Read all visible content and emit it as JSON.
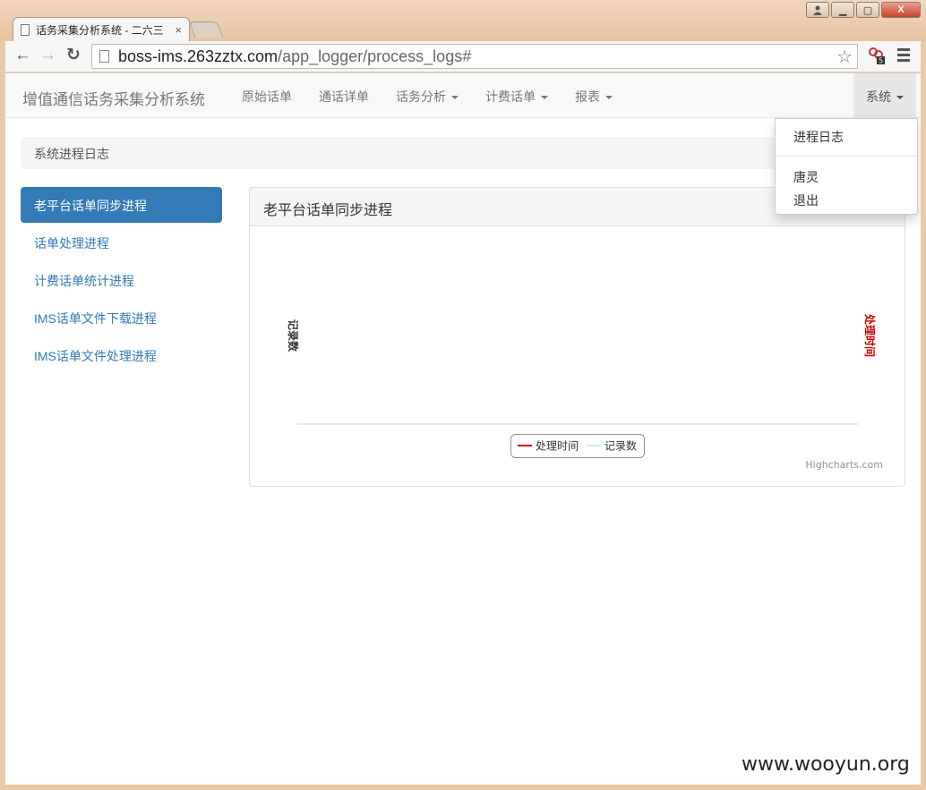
{
  "browser": {
    "tab_title": "话务采集分析系统 - 二六三",
    "tab_close": "×",
    "url_host": "boss-ims.263zztx.com",
    "url_path": "/app_logger/process_logs#",
    "ext_badge": "5",
    "window_buttons": {
      "minimize": "▁",
      "maximize": "▢",
      "close": "X"
    }
  },
  "navbar": {
    "brand": "增值通信话务采集分析系统",
    "items": [
      {
        "label": "原始话单",
        "dropdown": false
      },
      {
        "label": "通话详单",
        "dropdown": false
      },
      {
        "label": "话务分析",
        "dropdown": true
      },
      {
        "label": "计费话单",
        "dropdown": true
      },
      {
        "label": "报表",
        "dropdown": true
      }
    ],
    "system": {
      "label": "系统",
      "dropdown": true,
      "open": true
    }
  },
  "dropdown_menu": {
    "items": [
      "进程日志",
      "唐灵",
      "退出"
    ]
  },
  "breadcrumb": "系统进程日志",
  "sidebar": {
    "items": [
      {
        "label": "老平台话单同步进程",
        "active": true
      },
      {
        "label": "话单处理进程",
        "active": false
      },
      {
        "label": "计费话单统计进程",
        "active": false
      },
      {
        "label": "IMS话单文件下载进程",
        "active": false
      },
      {
        "label": "IMS话单文件处理进程",
        "active": false
      }
    ]
  },
  "panel": {
    "heading": "老平台话单同步进程"
  },
  "chart_data": {
    "type": "line",
    "title": "",
    "yaxis_left_label": "记录数",
    "yaxis_right_label": "处理时间",
    "series": [
      {
        "name": "处理时间",
        "color": "#cc0000",
        "values": []
      },
      {
        "name": "记录数",
        "color": "#c9ecf7",
        "values": []
      }
    ],
    "legend_position": "bottom-center",
    "credits": "Highcharts.com"
  },
  "colors": {
    "primary": "#337ab7",
    "navbar_bg": "#f8f8f8",
    "axis_right": "#cc0000"
  },
  "watermark": "www.wooyun.org"
}
